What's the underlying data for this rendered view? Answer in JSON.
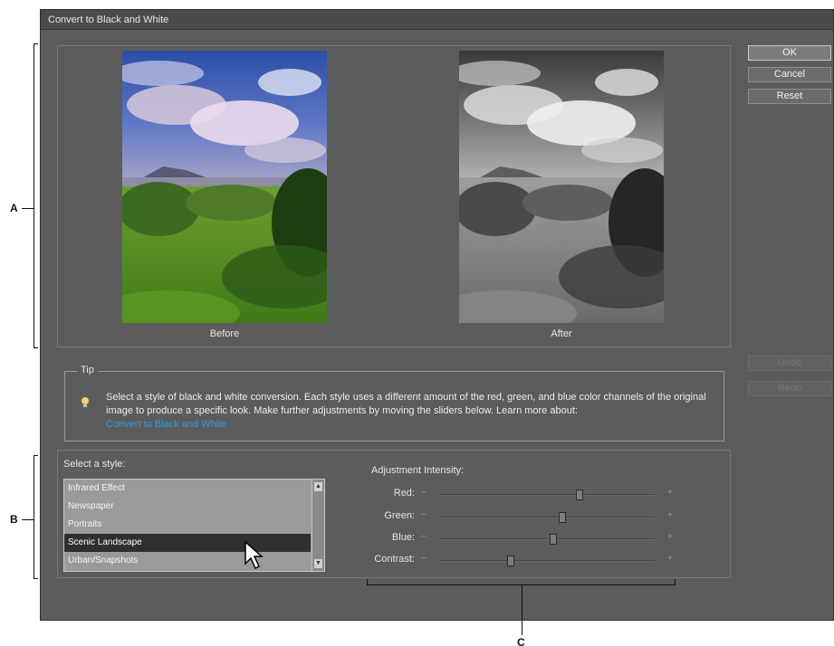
{
  "dialog": {
    "title": "Convert to Black and White"
  },
  "preview": {
    "before_label": "Before",
    "after_label": "After"
  },
  "buttons": {
    "ok": "OK",
    "cancel": "Cancel",
    "reset": "Reset",
    "undo": "Undo",
    "redo": "Redo"
  },
  "tip": {
    "legend": "Tip",
    "text": "Select a style of black and white conversion. Each style uses a different amount of the red, green, and blue color channels of the original image to produce a specific look. Make further adjustments by moving the sliders below. Learn more about:",
    "link": "Convert to Black and White"
  },
  "styles": {
    "label": "Select a style:",
    "items": [
      "Infrared Effect",
      "Newspaper",
      "Portraits",
      "Scenic Landscape",
      "Urban/Snapshots"
    ],
    "selected": "Scenic Landscape"
  },
  "adjustment": {
    "label": "Adjustment Intensity:",
    "minus": "−",
    "plus": "+",
    "sliders": [
      {
        "name": "Red:",
        "value": 0.65
      },
      {
        "name": "Green:",
        "value": 0.57
      },
      {
        "name": "Blue:",
        "value": 0.53
      },
      {
        "name": "Contrast:",
        "value": 0.33
      }
    ]
  },
  "annotations": {
    "a": "A",
    "b": "B",
    "c": "C"
  },
  "colors": {
    "link": "#2e9ce6",
    "dialog_bg": "#5c5c5c"
  }
}
